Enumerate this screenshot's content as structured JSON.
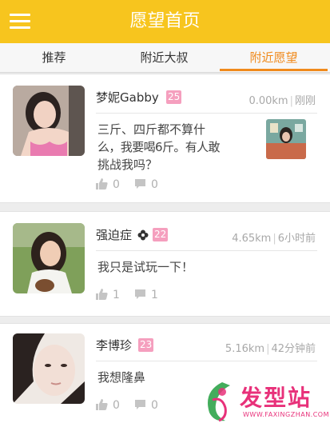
{
  "header": {
    "title": "愿望首页",
    "menu_icon": "hamburger-menu-icon"
  },
  "tabs": [
    {
      "label": "推荐"
    },
    {
      "label": "附近大叔"
    },
    {
      "label": "附近愿望"
    }
  ],
  "active_tab_index": 2,
  "accent_color": "#f08a1c",
  "header_color": "#f7c51e",
  "posts": [
    {
      "name": "梦妮Gabby",
      "age": "25",
      "distance": "0.00km",
      "time": "刚刚",
      "text_lines": [
        "三斤、四斤都不算什",
        "么，我要喝6斤。有人敢",
        "挑战我吗？"
      ],
      "likes": "0",
      "comments": "0",
      "has_thumbnail": true
    },
    {
      "name": "强迫症",
      "age": "22",
      "distance": "4.65km",
      "time": "6小时前",
      "text_lines": [
        "我只是试玩一下！"
      ],
      "likes": "1",
      "comments": "1",
      "has_thumbnail": false
    },
    {
      "name": "李博珍",
      "age": "23",
      "distance": "5.16km",
      "time": "42分钟前",
      "text_lines": [
        "我想隆鼻"
      ],
      "likes": "0",
      "comments": "0",
      "has_thumbnail": false
    }
  ],
  "watermark": {
    "brand": "发型站",
    "url": "WWW.FAXINGZHAN.COM"
  }
}
